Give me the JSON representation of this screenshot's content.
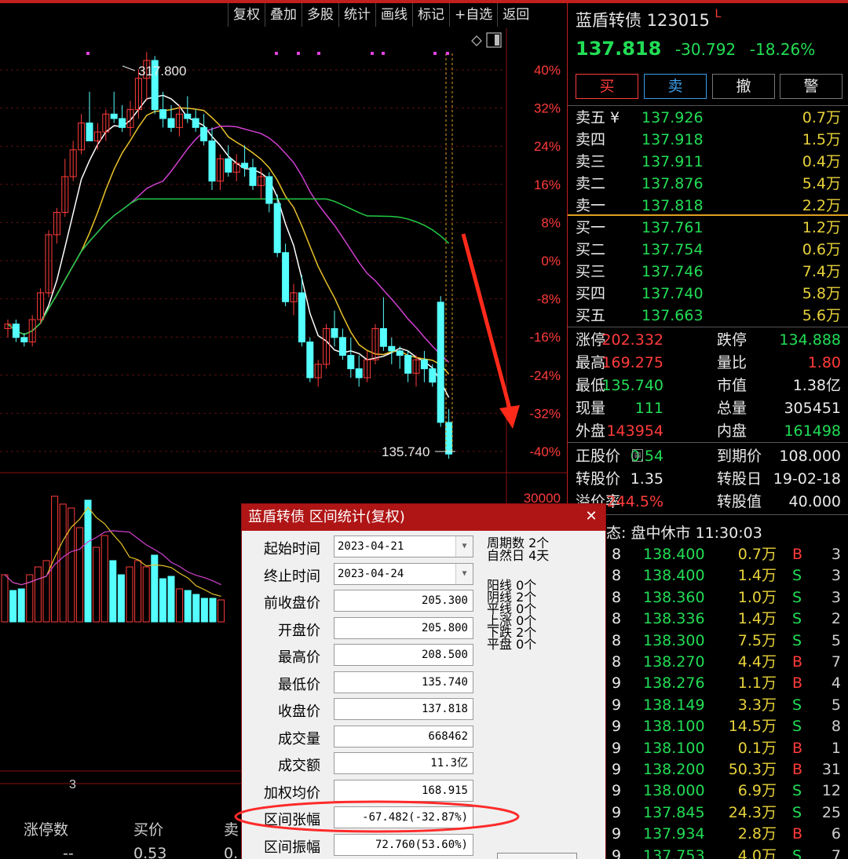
{
  "toolbar": {
    "items": [
      "复权",
      "叠加",
      "多股",
      "统计",
      "画线",
      "标记",
      "+自选",
      "返回"
    ]
  },
  "chart": {
    "high_label": "317.800",
    "low_label": "135.740",
    "pct_axis": [
      "40%",
      "32%",
      "24%",
      "16%",
      "8%",
      "0%",
      "-8%",
      "-16%",
      "-24%",
      "-32%",
      "-40%"
    ],
    "volume_axis": "30000",
    "volume_bottom_label": "3",
    "colors": {
      "up": "#ff3b3b",
      "down": "#55ffff",
      "ma5": "#ffffff",
      "ma10": "#e8c22a",
      "ma20": "#d040d0",
      "ma60": "#22cc44"
    }
  },
  "chart_data": {
    "type": "candlestick",
    "series": [
      {
        "name": "candles",
        "ohlc": [
          [
            194,
            198,
            190,
            196
          ],
          [
            196,
            198,
            188,
            190
          ],
          [
            190,
            192,
            186,
            188
          ],
          [
            188,
            200,
            186,
            198
          ],
          [
            198,
            212,
            196,
            210
          ],
          [
            210,
            238,
            208,
            236
          ],
          [
            236,
            248,
            232,
            246
          ],
          [
            246,
            270,
            244,
            262
          ],
          [
            262,
            278,
            260,
            274
          ],
          [
            274,
            290,
            272,
            286
          ],
          [
            286,
            300,
            280,
            278
          ],
          [
            278,
            286,
            274,
            282
          ],
          [
            282,
            292,
            278,
            290
          ],
          [
            290,
            300,
            286,
            288
          ],
          [
            288,
            294,
            282,
            284
          ],
          [
            284,
            296,
            280,
            292
          ],
          [
            292,
            310,
            288,
            306
          ],
          [
            306,
            317.8,
            296,
            314
          ],
          [
            314,
            316,
            290,
            292
          ],
          [
            292,
            300,
            284,
            288
          ],
          [
            288,
            294,
            282,
            284
          ],
          [
            284,
            294,
            280,
            290
          ],
          [
            290,
            298,
            286,
            288
          ],
          [
            288,
            292,
            282,
            284
          ],
          [
            284,
            290,
            276,
            278
          ],
          [
            278,
            284,
            256,
            260
          ],
          [
            260,
            272,
            256,
            270
          ],
          [
            270,
            276,
            262,
            264
          ],
          [
            264,
            272,
            260,
            268
          ],
          [
            268,
            276,
            262,
            266
          ],
          [
            266,
            270,
            256,
            258
          ],
          [
            258,
            266,
            252,
            262
          ],
          [
            262,
            264,
            246,
            250
          ],
          [
            250,
            254,
            226,
            228
          ],
          [
            228,
            232,
            204,
            206
          ],
          [
            206,
            214,
            200,
            210
          ],
          [
            210,
            218,
            186,
            188
          ],
          [
            188,
            190,
            170,
            172
          ],
          [
            172,
            180,
            168,
            178
          ],
          [
            178,
            196,
            176,
            194
          ],
          [
            194,
            202,
            186,
            190
          ],
          [
            190,
            194,
            180,
            182
          ],
          [
            182,
            190,
            172,
            176
          ],
          [
            176,
            182,
            168,
            172
          ],
          [
            172,
            184,
            170,
            180
          ],
          [
            180,
            196,
            178,
            194
          ],
          [
            194,
            208,
            184,
            186
          ],
          [
            186,
            190,
            178,
            184
          ],
          [
            184,
            186,
            176,
            182
          ],
          [
            182,
            184,
            170,
            174
          ],
          [
            174,
            182,
            168,
            180
          ],
          [
            180,
            184,
            170,
            176
          ],
          [
            176,
            178,
            168,
            170
          ],
          [
            205.8,
            208.5,
            150,
            152
          ],
          [
            152,
            158,
            135.74,
            137.818
          ]
        ]
      }
    ],
    "title": "蓝盾转债",
    "ylim": [
      133,
      327
    ],
    "pct_ylim": [
      "-40%",
      "40%"
    ]
  },
  "quote": {
    "name": "蓝盾转债 123015",
    "flag": "L",
    "price": "137.818",
    "change": "-30.792",
    "change_pct": "-18.26%",
    "buttons": [
      "买",
      "卖",
      "撤",
      "警"
    ]
  },
  "order_book": {
    "asks": [
      {
        "label": "卖五 ¥",
        "price": "137.926",
        "vol": "0.7万"
      },
      {
        "label": "卖四",
        "price": "137.918",
        "vol": "1.5万"
      },
      {
        "label": "卖三",
        "price": "137.911",
        "vol": "0.4万"
      },
      {
        "label": "卖二",
        "price": "137.876",
        "vol": "5.4万"
      },
      {
        "label": "卖一",
        "price": "137.818",
        "vol": "2.2万"
      }
    ],
    "bids": [
      {
        "label": "买一",
        "price": "137.761",
        "vol": "1.2万"
      },
      {
        "label": "买二",
        "price": "137.754",
        "vol": "0.6万"
      },
      {
        "label": "买三",
        "price": "137.746",
        "vol": "7.4万"
      },
      {
        "label": "买四",
        "price": "137.740",
        "vol": "5.8万"
      },
      {
        "label": "买五",
        "price": "137.663",
        "vol": "5.6万"
      }
    ]
  },
  "stats": [
    {
      "l1": "涨停",
      "v1": "202.332",
      "l2": "跌停",
      "v2": "134.888"
    },
    {
      "l1": "最高",
      "v1": "169.275",
      "l2": "量比",
      "v2": "1.80"
    },
    {
      "l1": "最低",
      "v1": "135.740",
      "l2": "市值",
      "v2": "1.38亿"
    },
    {
      "l1": "现量",
      "v1": "111",
      "l2": "总量",
      "v2": "305451"
    },
    {
      "l1": "外盘",
      "v1": "143954",
      "l2": "内盘",
      "v2": "161498"
    }
  ],
  "bond_info": [
    {
      "l1": "正股价",
      "v1": "0.54",
      "l2": "到期价",
      "v2": "108.000"
    },
    {
      "l1": "转股价",
      "v1": "1.35",
      "l2": "转股日",
      "v2": "19-02-18"
    },
    {
      "l1": "溢价率",
      "v1": "244.5%",
      "l2": "转股值",
      "v2": "40.000"
    }
  ],
  "tick_status": "状态: 盘中休市 11:30:03",
  "ticks": [
    {
      "t": "8",
      "price": "138.400",
      "vol": "0.7万",
      "bs": "B",
      "n": "3"
    },
    {
      "t": "8",
      "price": "138.400",
      "vol": "1.4万",
      "bs": "S",
      "n": "3"
    },
    {
      "t": "8",
      "price": "138.360",
      "vol": "1.0万",
      "bs": "S",
      "n": "3"
    },
    {
      "t": "8",
      "price": "138.336",
      "vol": "1.4万",
      "bs": "S",
      "n": "2"
    },
    {
      "t": "8",
      "price": "138.300",
      "vol": "7.5万",
      "bs": "S",
      "n": "5"
    },
    {
      "t": "8",
      "price": "138.270",
      "vol": "4.4万",
      "bs": "B",
      "n": "7"
    },
    {
      "t": "9",
      "price": "138.276",
      "vol": "1.1万",
      "bs": "B",
      "n": "4"
    },
    {
      "t": "9",
      "price": "138.149",
      "vol": "3.3万",
      "bs": "S",
      "n": "5"
    },
    {
      "t": "9",
      "price": "138.100",
      "vol": "14.5万",
      "bs": "S",
      "n": "8"
    },
    {
      "t": "9",
      "price": "138.100",
      "vol": "0.1万",
      "bs": "B",
      "n": "1"
    },
    {
      "t": "9",
      "price": "138.200",
      "vol": "50.3万",
      "bs": "B",
      "n": "31"
    },
    {
      "t": "9",
      "price": "138.000",
      "vol": "6.9万",
      "bs": "S",
      "n": "12"
    },
    {
      "t": "9",
      "price": "137.845",
      "vol": "24.3万",
      "bs": "S",
      "n": "25"
    },
    {
      "t": "9",
      "price": "137.934",
      "vol": "2.8万",
      "bs": "B",
      "n": "6"
    },
    {
      "t": "9",
      "price": "137.753",
      "vol": "4.0万",
      "bs": "S",
      "n": "7"
    }
  ],
  "dialog": {
    "title": "蓝盾转债 区间统计(复权)",
    "fields": [
      {
        "label": "起始时间",
        "value": "2023-04-21",
        "combo": true
      },
      {
        "label": "终止时间",
        "value": "2023-04-24",
        "combo": true
      },
      {
        "label": "前收盘价",
        "value": "205.300"
      },
      {
        "label": "开盘价",
        "value": "205.800"
      },
      {
        "label": "最高价",
        "value": "208.500"
      },
      {
        "label": "最低价",
        "value": "135.740"
      },
      {
        "label": "收盘价",
        "value": "137.818"
      },
      {
        "label": "成交量",
        "value": "668462"
      },
      {
        "label": "成交额",
        "value": "11.3亿"
      },
      {
        "label": "加权均价",
        "value": "168.915"
      },
      {
        "label": "区间张幅",
        "value": "-67.482(-32.87%)"
      },
      {
        "label": "区间振幅",
        "value": "72.760(53.60%)"
      }
    ],
    "period_count": "周期数 2个",
    "natural_days": "自然日 4天",
    "counts": [
      "阳线 0个",
      "阴线 2个",
      "平线 0个",
      "上涨 0个",
      "下跌 2个",
      "平盘 0个"
    ]
  },
  "bottom_table": {
    "headers": [
      "涨停数",
      "买价",
      "卖"
    ],
    "values": [
      "--",
      "0.53",
      "0."
    ]
  }
}
